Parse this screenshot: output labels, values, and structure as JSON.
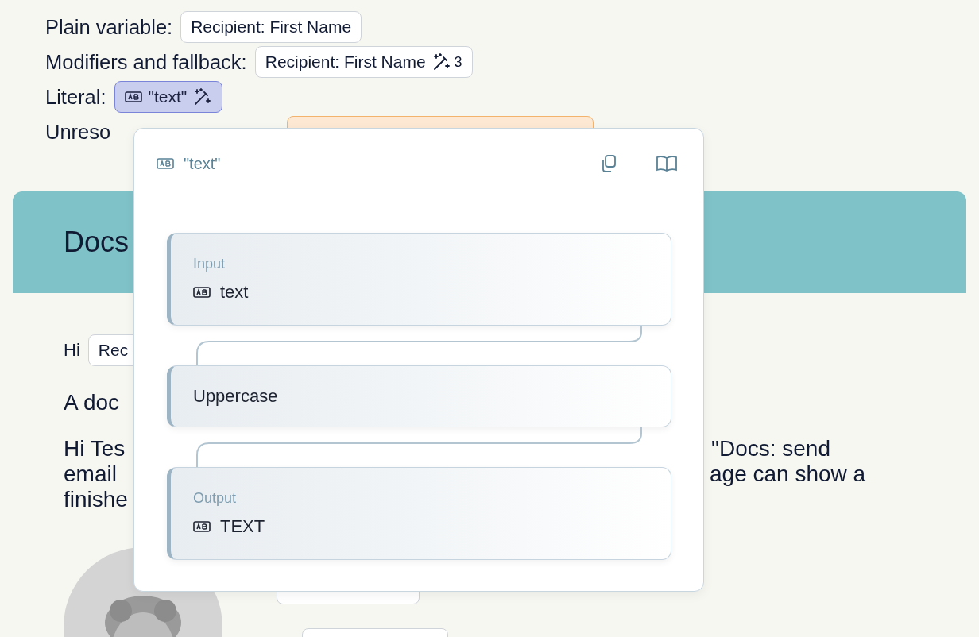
{
  "examples": [
    {
      "label": "Plain variable:",
      "chip": {
        "kind": "variable",
        "text": "Recipient: First Name"
      }
    },
    {
      "label": "Modifiers and fallback:",
      "chip": {
        "kind": "variable",
        "text": "Recipient: First Name",
        "modified": true,
        "modifier_count": "3"
      }
    },
    {
      "label": "Literal:",
      "chip": {
        "kind": "literal",
        "text": "\"text\"",
        "modified": true
      }
    },
    {
      "label": "Unreso",
      "chip": {
        "kind": "unresolved"
      }
    }
  ],
  "card": {
    "title": "Docs",
    "greeting": "Hi",
    "greeting_chip": "Rec",
    "intro": "A doc",
    "paragraph_left": [
      "Hi Tes",
      "email",
      "finishe"
    ],
    "paragraph_right": [
      "\"Docs: send",
      "age can show a"
    ]
  },
  "popover": {
    "title": "\"text\"",
    "steps": [
      {
        "kind": "input",
        "label": "Input",
        "value": "text"
      },
      {
        "kind": "modifier",
        "name": "Uppercase"
      },
      {
        "kind": "output",
        "label": "Output",
        "value": "TEXT"
      }
    ]
  }
}
